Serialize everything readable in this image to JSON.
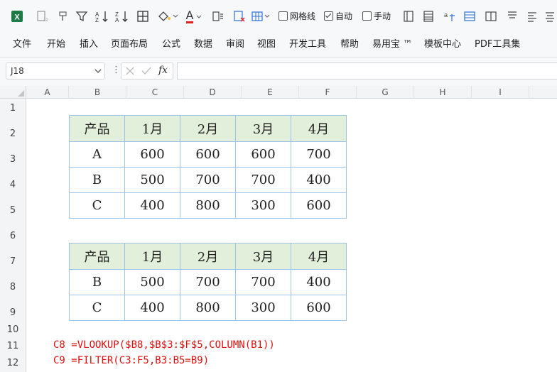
{
  "toolbar": {
    "icons": [
      "excel-logo",
      "format-painter",
      "number-format",
      "filter",
      "sort-ascending",
      "sort-descending",
      "borders",
      "fill-color",
      "font-color",
      "convert",
      "clear",
      "insert-cells"
    ],
    "checkboxes": [
      {
        "label": "网格线",
        "checked": false
      },
      {
        "label": "自动",
        "checked": true
      },
      {
        "label": "手动",
        "checked": false
      }
    ],
    "font_color_letter": "A"
  },
  "menu": [
    "文件",
    "开始",
    "插入",
    "页面布局",
    "公式",
    "数据",
    "审阅",
    "视图",
    "开发工具",
    "帮助",
    "易用宝 ™",
    "模板中心",
    "PDF工具集"
  ],
  "formula_bar": {
    "name_box": "J18",
    "fx": "fx",
    "formula": ""
  },
  "columns": [
    "A",
    "B",
    "C",
    "D",
    "E",
    "F",
    "G",
    "H",
    "I"
  ],
  "rows": [
    "1",
    "2",
    "3",
    "4",
    "5",
    "6",
    "7",
    "8",
    "9",
    "10",
    "11",
    "12"
  ],
  "table1": {
    "header": [
      "产品",
      "1月",
      "2月",
      "3月",
      "4月"
    ],
    "rows": [
      [
        "A",
        "600",
        "600",
        "600",
        "700"
      ],
      [
        "B",
        "500",
        "700",
        "700",
        "400"
      ],
      [
        "C",
        "400",
        "800",
        "300",
        "600"
      ]
    ]
  },
  "table2": {
    "header": [
      "产品",
      "1月",
      "2月",
      "3月",
      "4月"
    ],
    "rows": [
      [
        "B",
        "500",
        "700",
        "700",
        "400"
      ],
      [
        "C",
        "400",
        "800",
        "300",
        "600"
      ]
    ]
  },
  "notes": [
    "C8 =VLOOKUP($B8,$B$3:$F$5,COLUMN(B1))",
    "C9 =FILTER(C3:F5,B3:B5=B9)"
  ],
  "colors": {
    "accent_red": "#e01010",
    "header_fill": "#e2efda",
    "table_border": "#9dc3e6"
  }
}
